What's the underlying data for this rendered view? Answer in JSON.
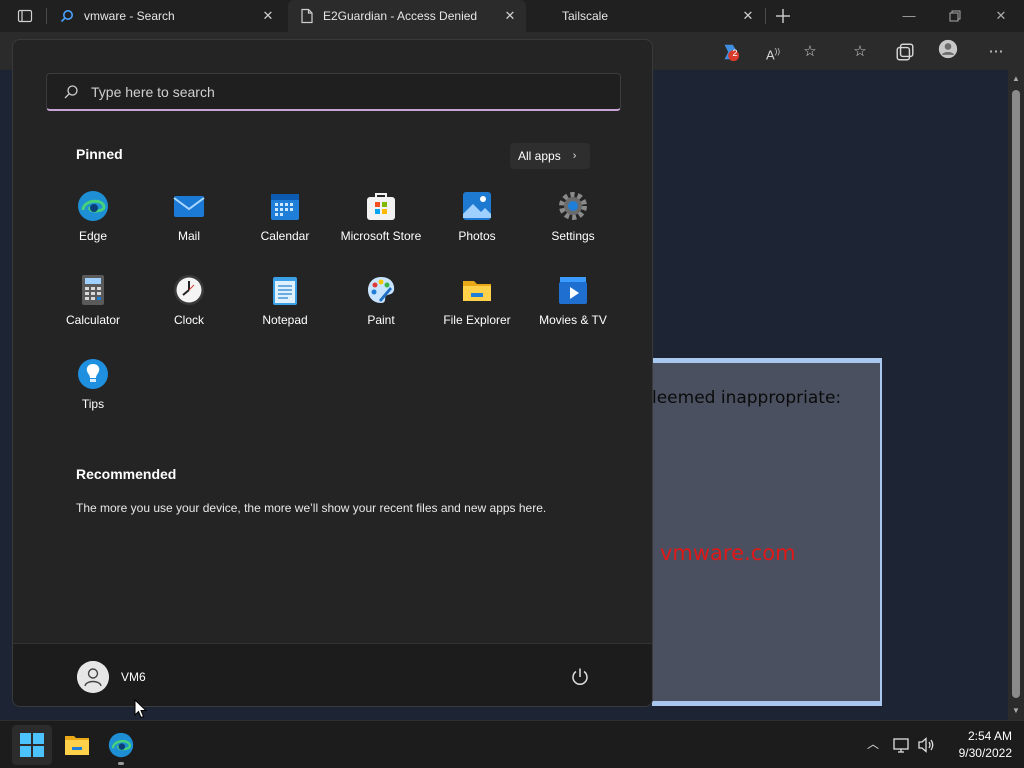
{
  "browser": {
    "tabs": [
      {
        "title": "vmware - Search",
        "icon": "search-icon"
      },
      {
        "title": "E2Guardian - Access Denied",
        "icon": "document-icon"
      },
      {
        "title": "Tailscale",
        "icon": ""
      }
    ],
    "badge_count": "2"
  },
  "webpage": {
    "deemed_text": "leemed inappropriate:",
    "blocked_url": "vmware.com"
  },
  "start_menu": {
    "search_placeholder": "Type here to search",
    "pinned_heading": "Pinned",
    "all_apps_label": "All apps",
    "pinned_apps": [
      {
        "label": "Edge",
        "icon": "edge-icon"
      },
      {
        "label": "Mail",
        "icon": "mail-icon"
      },
      {
        "label": "Calendar",
        "icon": "calendar-icon"
      },
      {
        "label": "Microsoft Store",
        "icon": "store-icon"
      },
      {
        "label": "Photos",
        "icon": "photos-icon"
      },
      {
        "label": "Settings",
        "icon": "gear-icon"
      },
      {
        "label": "Calculator",
        "icon": "calculator-icon"
      },
      {
        "label": "Clock",
        "icon": "clock-icon"
      },
      {
        "label": "Notepad",
        "icon": "notepad-icon"
      },
      {
        "label": "Paint",
        "icon": "paint-icon"
      },
      {
        "label": "File Explorer",
        "icon": "folder-icon"
      },
      {
        "label": "Movies & TV",
        "icon": "movies-icon"
      },
      {
        "label": "Tips",
        "icon": "lightbulb-icon"
      }
    ],
    "recommended_heading": "Recommended",
    "recommended_text": "The more you use your device, the more we’ll show your recent files and new apps here.",
    "user_name": "VM6"
  },
  "taskbar": {
    "time": "2:54 AM",
    "date": "9/30/2022"
  },
  "colors": {
    "accent": "#0078d4",
    "search_underline": "#c9a3d6",
    "blocked_url": "#e01818"
  }
}
